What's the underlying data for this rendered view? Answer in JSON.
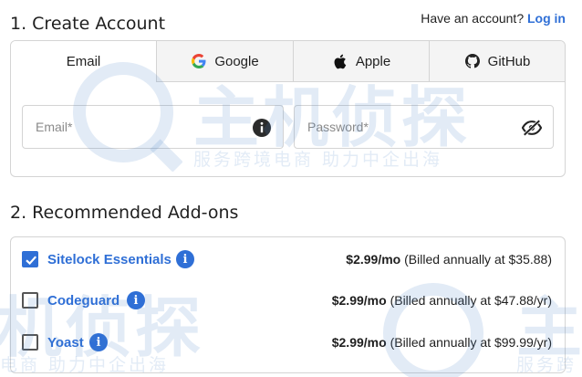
{
  "create_account": {
    "title": "1. Create Account",
    "have_account_text": "Have an account?",
    "login_link": "Log in",
    "tabs": [
      {
        "label": "Email",
        "icon": "mail-icon",
        "active": true
      },
      {
        "label": "Google",
        "icon": "google-icon",
        "active": false
      },
      {
        "label": "Apple",
        "icon": "apple-icon",
        "active": false
      },
      {
        "label": "GitHub",
        "icon": "github-icon",
        "active": false
      }
    ],
    "email_placeholder": "Email*",
    "password_placeholder": "Password*"
  },
  "addons": {
    "title": "2. Recommended Add-ons",
    "items": [
      {
        "name": "Sitelock Essentials",
        "checked": true,
        "price": "$2.99/mo",
        "billing": "(Billed annually at $35.88)"
      },
      {
        "name": "Codeguard",
        "checked": false,
        "price": "$2.99/mo",
        "billing": "(Billed annually at $47.88/yr)"
      },
      {
        "name": "Yoast",
        "checked": false,
        "price": "$2.99/mo",
        "billing": "(Billed annually at $99.99/yr)"
      }
    ]
  },
  "watermark": {
    "big_text_1": "主机侦探",
    "small_text_1": "服务跨境电商 助力中企出海",
    "big_text_2": "机侦探",
    "small_text_2": "电商 助力中企出海",
    "big_text_3": "主",
    "small_text_3": "服务跨"
  },
  "colors": {
    "accent": "#2f6fd6",
    "border": "#d4d4d4",
    "tab_inactive": "#f4f4f4"
  }
}
